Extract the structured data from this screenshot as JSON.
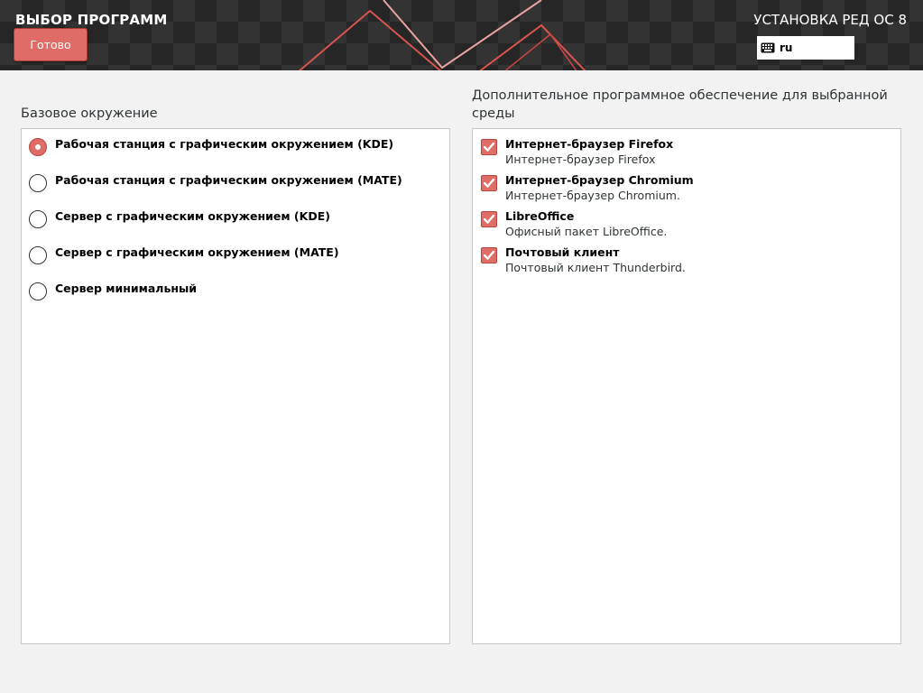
{
  "header": {
    "title": "ВЫБОР ПРОГРАММ",
    "done_label": "Готово",
    "product": "УСТАНОВКА РЕД ОС 8",
    "keyboard_layout": "ru"
  },
  "base_environment": {
    "label": "Базовое окружение",
    "selected_index": 0,
    "items": [
      {
        "label": "Рабочая станция с графическим окружением (KDE)",
        "selected": true
      },
      {
        "label": "Рабочая станция с графическим окружением (MATE)",
        "selected": false
      },
      {
        "label": "Сервер с графическим окружением (KDE)",
        "selected": false
      },
      {
        "label": "Сервер с графическим окружением (MATE)",
        "selected": false
      },
      {
        "label": "Сервер минимальный",
        "selected": false
      }
    ]
  },
  "addons": {
    "label": "Дополнительное программное обеспечение для выбранной среды",
    "items": [
      {
        "name": "Интернет-браузер Firefox",
        "description": "Интернет-браузер Firefox",
        "checked": true
      },
      {
        "name": "Интернет-браузер Chromium",
        "description": "Интернет-браузер Chromium.",
        "checked": true
      },
      {
        "name": "LibreOffice",
        "description": "Офисный пакет LibreOffice.",
        "checked": true
      },
      {
        "name": "Почтовый клиент",
        "description": "Почтовый клиент Thunderbird.",
        "checked": true
      }
    ]
  },
  "colors": {
    "accent": "#e06c68",
    "header_bg": "#2d2d2d",
    "page_bg": "#f2f2f2"
  },
  "icons": {
    "keyboard": "keyboard-icon",
    "radio": "radio-button",
    "checkbox": "checkmark-icon"
  }
}
